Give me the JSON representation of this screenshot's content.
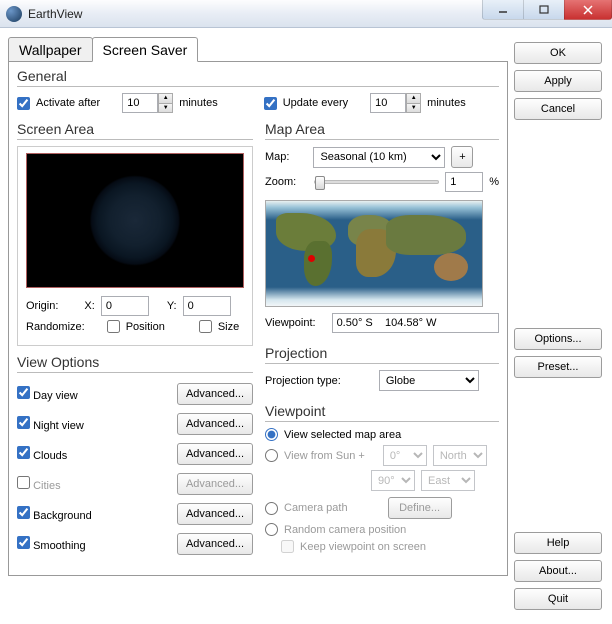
{
  "window": {
    "title": "EarthView"
  },
  "tabs": {
    "wallpaper": "Wallpaper",
    "screensaver": "Screen Saver"
  },
  "general": {
    "title": "General",
    "activate_after": "Activate after",
    "activate_minutes": "10",
    "minutes": "minutes",
    "update_every": "Update every",
    "update_minutes": "10"
  },
  "screen_area": {
    "title": "Screen Area",
    "origin": "Origin:",
    "x_label": "X:",
    "x": "0",
    "y_label": "Y:",
    "y": "0",
    "randomize": "Randomize:",
    "position": "Position",
    "size": "Size"
  },
  "view_options": {
    "title": "View Options",
    "day": "Day view",
    "night": "Night view",
    "clouds": "Clouds",
    "cities": "Cities",
    "background": "Background",
    "smoothing": "Smoothing",
    "advanced": "Advanced..."
  },
  "map_area": {
    "title": "Map Area",
    "map_label": "Map:",
    "map_value": "Seasonal (10 km)",
    "plus": "+",
    "zoom_label": "Zoom:",
    "zoom_value": "1",
    "percent": "%",
    "viewpoint_label": "Viewpoint:",
    "viewpoint_value": "0.50° S    104.58° W"
  },
  "projection": {
    "title": "Projection",
    "type_label": "Projection type:",
    "type_value": "Globe"
  },
  "viewpoint": {
    "title": "Viewpoint",
    "view_selected": "View selected map area",
    "view_from_sun": "View from Sun +",
    "sun_deg1": "0°",
    "sun_dir1": "North",
    "sun_deg2": "90°",
    "sun_dir2": "East",
    "camera_path": "Camera path",
    "define": "Define...",
    "random": "Random camera position",
    "keep": "Keep viewpoint on screen"
  },
  "side": {
    "ok": "OK",
    "apply": "Apply",
    "cancel": "Cancel",
    "options": "Options...",
    "preset": "Preset...",
    "help": "Help",
    "about": "About...",
    "quit": "Quit"
  }
}
